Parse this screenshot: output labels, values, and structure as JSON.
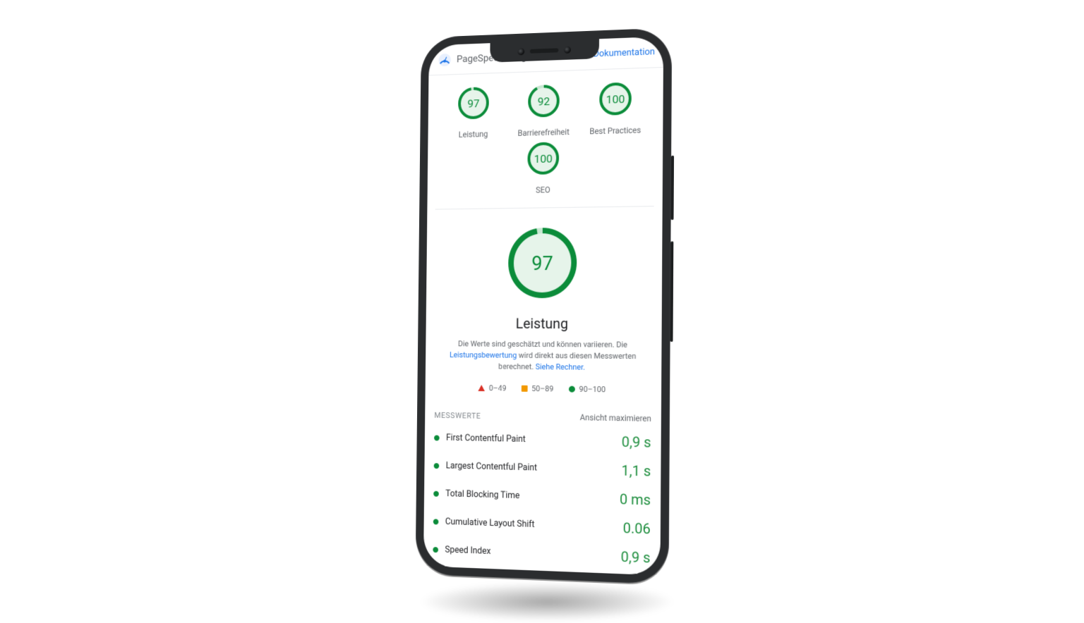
{
  "header": {
    "app_title": "PageSpeed Insights",
    "documentation_label": "Dokumentation"
  },
  "scores": [
    {
      "label": "Leistung",
      "value": 97
    },
    {
      "label": "Barrierefreiheit",
      "value": 92
    },
    {
      "label": "Best Practices",
      "value": 100
    },
    {
      "label": "SEO",
      "value": 100
    }
  ],
  "main_score": {
    "value": 97,
    "title": "Leistung",
    "desc_pre": "Die Werte sind geschätzt und können variieren. Die ",
    "desc_link1": "Leistungsbewertung",
    "desc_mid": " wird direkt aus diesen Messwerten berechnet. ",
    "desc_link2": "Siehe Rechner."
  },
  "legend": {
    "bad": "0–49",
    "avg": "50–89",
    "good": "90–100"
  },
  "metrics_section": {
    "heading": "MESSWERTE",
    "expand_label": "Ansicht maximieren"
  },
  "metrics": [
    {
      "name": "First Contentful Paint",
      "value": "0,9 s"
    },
    {
      "name": "Largest Contentful Paint",
      "value": "1,1 s"
    },
    {
      "name": "Total Blocking Time",
      "value": "0 ms"
    },
    {
      "name": "Cumulative Layout Shift",
      "value": "0.06"
    },
    {
      "name": "Speed Index",
      "value": "0,9 s"
    }
  ],
  "colors": {
    "good": "#0b8c3a",
    "good_bg": "#e6f4ea"
  }
}
